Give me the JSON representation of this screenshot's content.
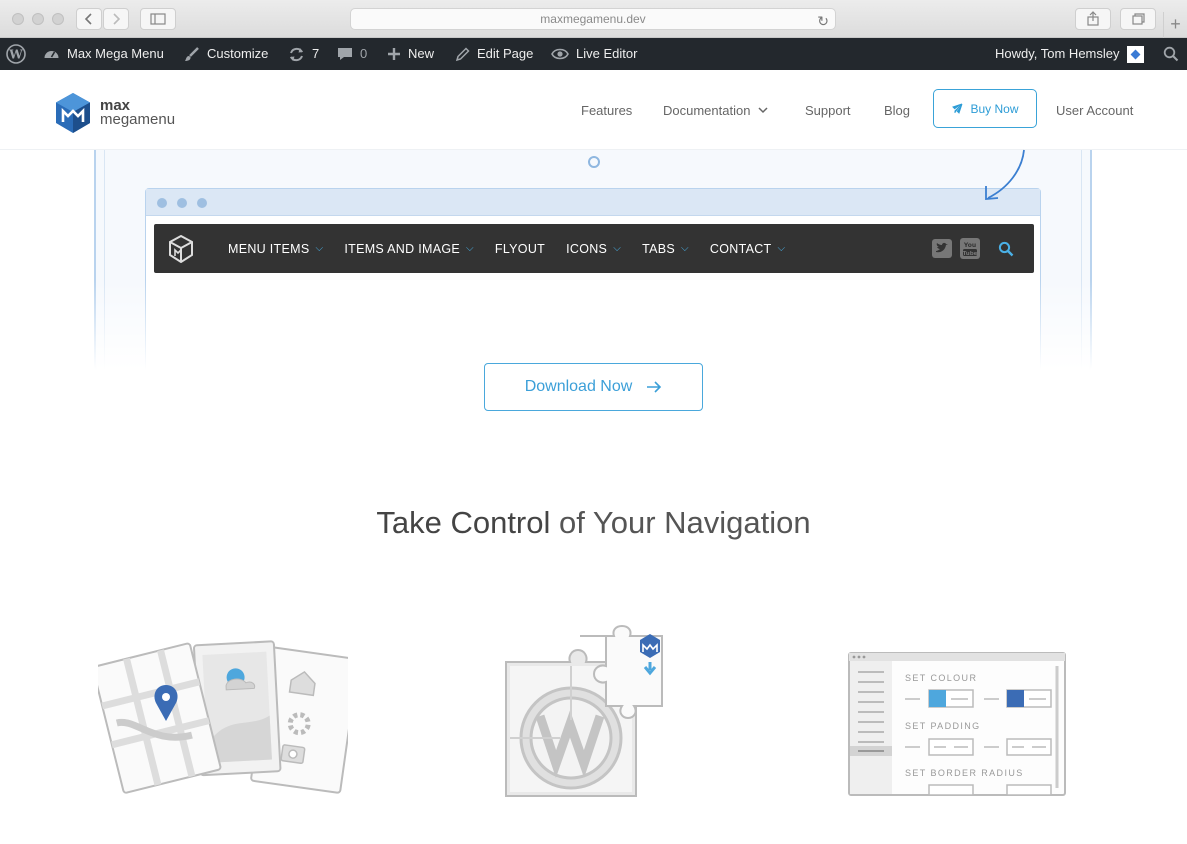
{
  "browser": {
    "url": "maxmegamenu.dev"
  },
  "adminbar": {
    "site_name": "Max Mega Menu",
    "customize": "Customize",
    "updates_count": "7",
    "comments_count": "0",
    "new_label": "New",
    "edit_page": "Edit Page",
    "live_editor": "Live Editor",
    "howdy": "Howdy, Tom Hemsley"
  },
  "header": {
    "logo_line1": "max",
    "logo_line2": "megamenu",
    "nav": {
      "features": "Features",
      "documentation": "Documentation",
      "support": "Support",
      "blog": "Blog",
      "buy_now": "Buy Now",
      "user_account": "User Account"
    }
  },
  "demo_menu": {
    "items": [
      "MENU ITEMS",
      "ITEMS AND IMAGE",
      "FLYOUT",
      "ICONS",
      "TABS",
      "CONTACT"
    ],
    "social_youtube": "You Tube"
  },
  "hero": {
    "download_label": "Download Now"
  },
  "section": {
    "title_bold": "Take Control",
    "title_rest": " of Your Navigation"
  },
  "settings_panel": {
    "set_colour": "SET COLOUR",
    "set_padding": "SET PADDING",
    "set_border_radius": "SET BORDER RADIUS"
  },
  "colors": {
    "accent": "#3b9fd8",
    "adminbar_bg": "#23282d",
    "demo_menu_bg": "#333333",
    "swatch_light_blue": "#4ea7dd",
    "swatch_dark_blue": "#3b6cb5",
    "pin_blue": "#3b6cb5"
  }
}
